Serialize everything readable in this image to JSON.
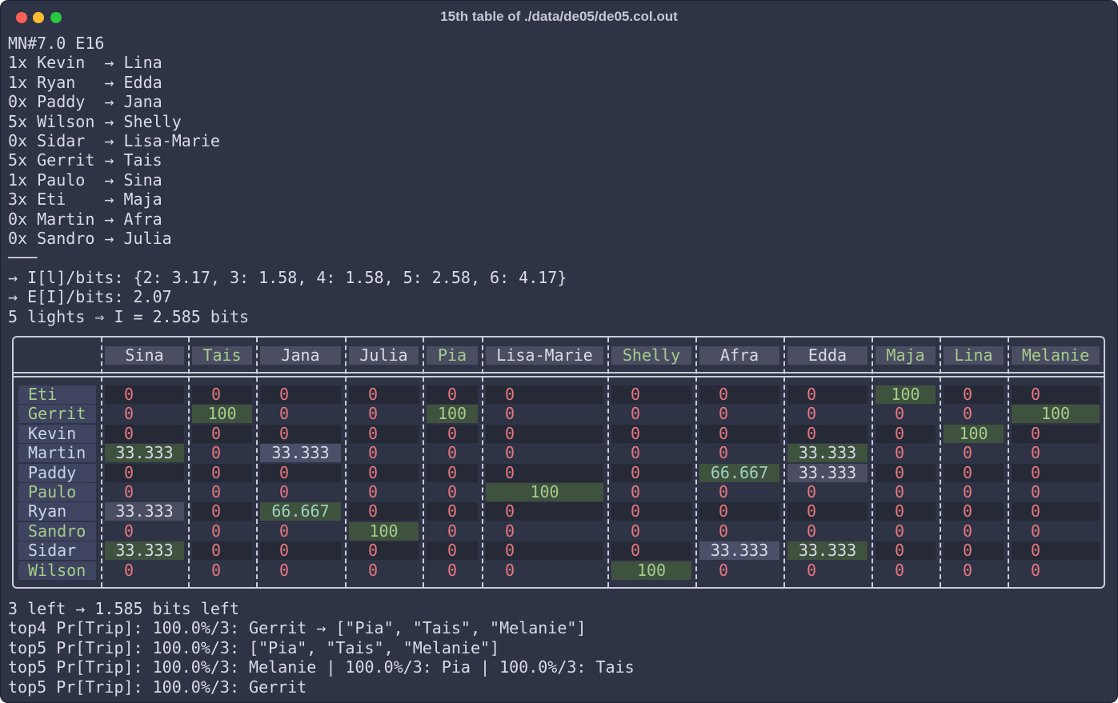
{
  "window": {
    "title": "15th table of ./data/de05/de05.col.out"
  },
  "header_lines": [
    "MN#7.0 E16",
    "1x Kevin  → Lina",
    "1x Ryan   → Edda",
    "0x Paddy  → Jana",
    "5x Wilson → Shelly",
    "0x Sidar  → Lisa-Marie",
    "5x Gerrit → Tais",
    "1x Paulo  → Sina",
    "3x Eti    → Maja",
    "0x Martin → Afra",
    "0x Sandro → Julia",
    "───",
    "→ I[l]/bits: {2: 3.17, 3: 1.58, 4: 1.58, 5: 2.58, 6: 4.17}",
    "→ E[I]/bits: 2.07",
    "5 lights ⇒ I = 2.585 bits"
  ],
  "table": {
    "columns": [
      "Sina",
      "Tais",
      "Jana",
      "Julia",
      "Pia",
      "Lisa-Marie",
      "Shelly",
      "Afra",
      "Edda",
      "Maja",
      "Lina",
      "Melanie"
    ],
    "rows": [
      {
        "name": "Eti",
        "values": [
          "0",
          "0",
          "0",
          "0",
          "0",
          "0",
          "0",
          "0",
          "0",
          "100",
          "0",
          "0"
        ]
      },
      {
        "name": "Gerrit",
        "values": [
          "0",
          "100",
          "0",
          "0",
          "100",
          "0",
          "0",
          "0",
          "0",
          "0",
          "0",
          "100"
        ]
      },
      {
        "name": "Kevin",
        "values": [
          "0",
          "0",
          "0",
          "0",
          "0",
          "0",
          "0",
          "0",
          "0",
          "0",
          "100",
          "0"
        ]
      },
      {
        "name": "Martin",
        "values": [
          "33.333",
          "0",
          "33.333",
          "0",
          "0",
          "0",
          "0",
          "0",
          "33.333",
          "0",
          "0",
          "0"
        ]
      },
      {
        "name": "Paddy",
        "values": [
          "0",
          "0",
          "0",
          "0",
          "0",
          "0",
          "0",
          "66.667",
          "33.333",
          "0",
          "0",
          "0"
        ]
      },
      {
        "name": "Paulo",
        "values": [
          "0",
          "0",
          "0",
          "0",
          "0",
          "100",
          "0",
          "0",
          "0",
          "0",
          "0",
          "0"
        ]
      },
      {
        "name": "Ryan",
        "values": [
          "33.333",
          "0",
          "66.667",
          "0",
          "0",
          "0",
          "0",
          "0",
          "0",
          "0",
          "0",
          "0"
        ]
      },
      {
        "name": "Sandro",
        "values": [
          "0",
          "0",
          "0",
          "100",
          "0",
          "0",
          "0",
          "0",
          "0",
          "0",
          "0",
          "0"
        ]
      },
      {
        "name": "Sidar",
        "values": [
          "33.333",
          "0",
          "0",
          "0",
          "0",
          "0",
          "0",
          "33.333",
          "33.333",
          "0",
          "0",
          "0"
        ]
      },
      {
        "name": "Wilson",
        "values": [
          "0",
          "0",
          "0",
          "0",
          "0",
          "0",
          "100",
          "0",
          "0",
          "0",
          "0",
          "0"
        ]
      }
    ]
  },
  "footer_lines": [
    "3 left → 1.585 bits left",
    "top4 Pr[Trip]: 100.0%/3: Gerrit → [\"Pia\", \"Tais\", \"Melanie\"]",
    "top5 Pr[Trip]: 100.0%/3: [\"Pia\", \"Tais\", \"Melanie\"]",
    "top5 Pr[Trip]: 100.0%/3: Melanie | 100.0%/3: Pia | 100.0%/3: Tais",
    "top5 Pr[Trip]: 100.0%/3: Gerrit"
  ],
  "colors": {
    "background": "#2f3346",
    "zero_value": "#e5777f",
    "highlight_green": "#a6cc8b",
    "border": "#c8ccda"
  }
}
